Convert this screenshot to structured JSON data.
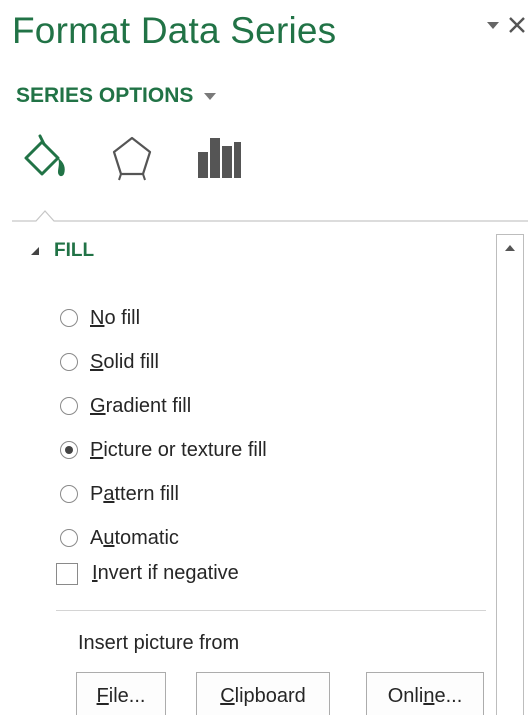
{
  "pane": {
    "title": "Format Data Series",
    "menu_icon": "pane-options-arrow-icon",
    "close_icon": "close-icon"
  },
  "series_options": {
    "label": "SERIES OPTIONS",
    "icon": "chevron-down-icon"
  },
  "tabs": [
    {
      "name": "fill-line",
      "icon": "paint-bucket-icon"
    },
    {
      "name": "effects",
      "icon": "pentagon-icon"
    },
    {
      "name": "series-options",
      "icon": "bar-chart-icon"
    }
  ],
  "fill_section": {
    "header": "FILL",
    "expanded": true,
    "options": [
      {
        "pre": "",
        "u": "N",
        "post": "o fill",
        "selected": false
      },
      {
        "pre": "",
        "u": "S",
        "post": "olid fill",
        "selected": false
      },
      {
        "pre": "",
        "u": "G",
        "post": "radient fill",
        "selected": false
      },
      {
        "pre": "",
        "u": "P",
        "post": "icture or texture fill",
        "selected": true
      },
      {
        "pre": "P",
        "u": "a",
        "post": "ttern fill",
        "selected": false
      },
      {
        "pre": "A",
        "u": "u",
        "post": "tomatic",
        "selected": false
      }
    ],
    "invert": {
      "pre": "",
      "u": "I",
      "post": "nvert if negative",
      "checked": false
    },
    "insert_label": "Insert picture from",
    "buttons": {
      "file": {
        "pre": "",
        "u": "F",
        "post": "ile..."
      },
      "clipboard": {
        "pre": "",
        "u": "C",
        "post": "lipboard"
      },
      "online": {
        "pre": "Onli",
        "u": "n",
        "post": "e..."
      }
    }
  },
  "colors": {
    "accent": "#217346",
    "text": "#262626",
    "border": "#acacac"
  }
}
